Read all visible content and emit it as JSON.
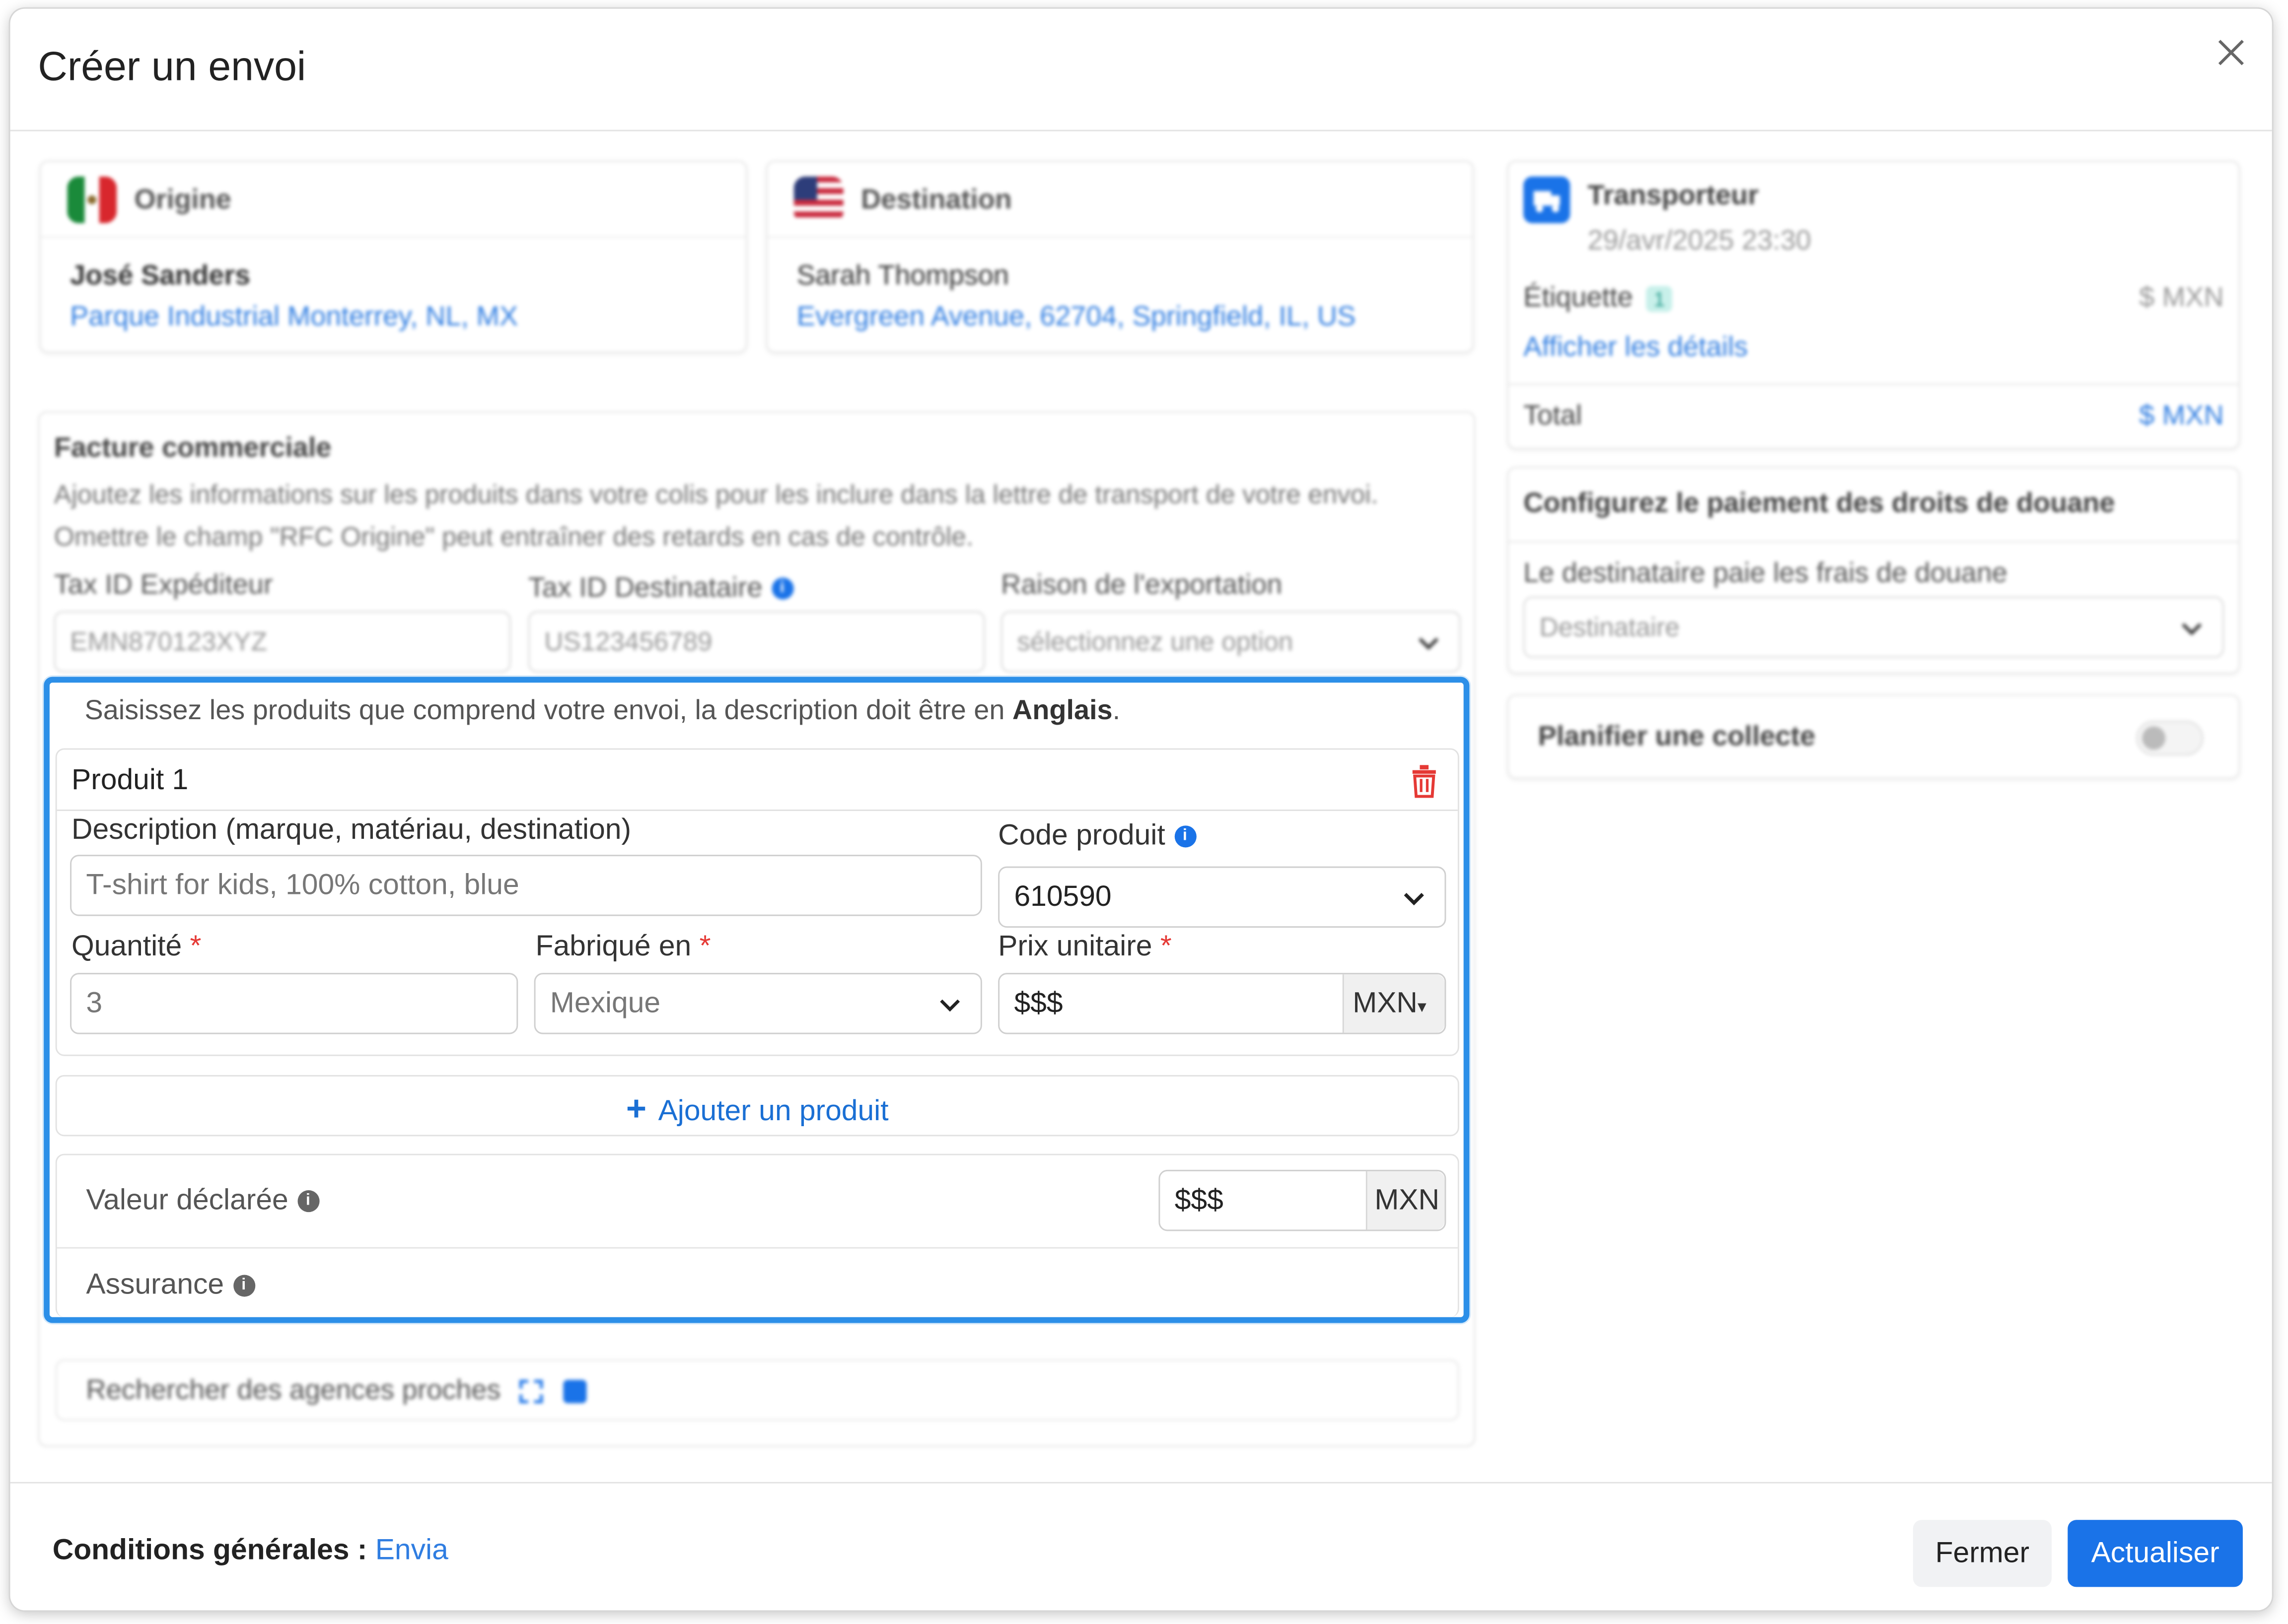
{
  "modal": {
    "title": "Créer un envoi"
  },
  "origin": {
    "label": "Origine",
    "name": "José Sanders",
    "address": "Parque Industrial Monterrey, NL, MX"
  },
  "destination": {
    "label": "Destination",
    "name": "Sarah Thompson",
    "address": "Evergreen Avenue, 62704, Springfield, IL, US"
  },
  "invoice": {
    "title": "Facture commerciale",
    "description": "Ajoutez les informations sur les produits dans votre colis pour les inclure dans la lettre de transport de votre envoi. Omettre le champ \"RFC Origine\" peut entraîner des retards en cas de contrôle.",
    "sender_tax_label": "Tax ID Expéditeur",
    "sender_tax_placeholder": "EMN870123XYZ",
    "recipient_tax_label": "Tax ID Destinataire",
    "recipient_tax_placeholder": "US123456789",
    "export_reason_label": "Raison de l'exportation",
    "export_reason_placeholder": "sélectionnez une option"
  },
  "products": {
    "intro": "Saisissez les produits que comprend votre envoi, la description doit être en ",
    "intro_lang": "Anglais",
    "intro_end": ".",
    "product_title": "Produit 1",
    "description_label": "Description (marque, matériau, destination)",
    "description_placeholder": "T-shirt for kids, 100% cotton, blue",
    "code_label": "Code produit",
    "code_value": "610590",
    "quantity_label": "Quantité",
    "quantity_placeholder": "3",
    "made_in_label": "Fabriqué en",
    "made_in_value": "Mexique",
    "unit_price_label": "Prix unitaire",
    "unit_price_placeholder": "$$$",
    "unit_price_currency": "MXN",
    "required_mark": "*",
    "add_product": "Ajouter un produit",
    "declared_value_label": "Valeur déclarée",
    "declared_value_placeholder": "$$$",
    "declared_value_currency": "MXN",
    "insurance_label": "Assurance"
  },
  "search_agencies": "Rechercher des agences proches",
  "carrier": {
    "title": "Transporteur",
    "date": "29/avr/2025 23:30",
    "label_text": "Étiquette",
    "label_count": "1",
    "label_price": "$ MXN",
    "details_link": "Afficher les détails",
    "total_label": "Total",
    "total_value": "$ MXN"
  },
  "customs": {
    "title": "Configurez le paiement des droits de douane",
    "payer_label": "Le destinataire paie les frais de douane",
    "payer_value": "Destinataire"
  },
  "pickup": {
    "label": "Planifier une collecte"
  },
  "footer": {
    "terms_label": "Conditions générales :",
    "terms_link": "Envia",
    "close_button": "Fermer",
    "update_button": "Actualiser"
  },
  "colors": {
    "accent": "#1a73e8",
    "highlight": "#2c8fe8",
    "required": "#e53935",
    "danger": "#e53935"
  }
}
